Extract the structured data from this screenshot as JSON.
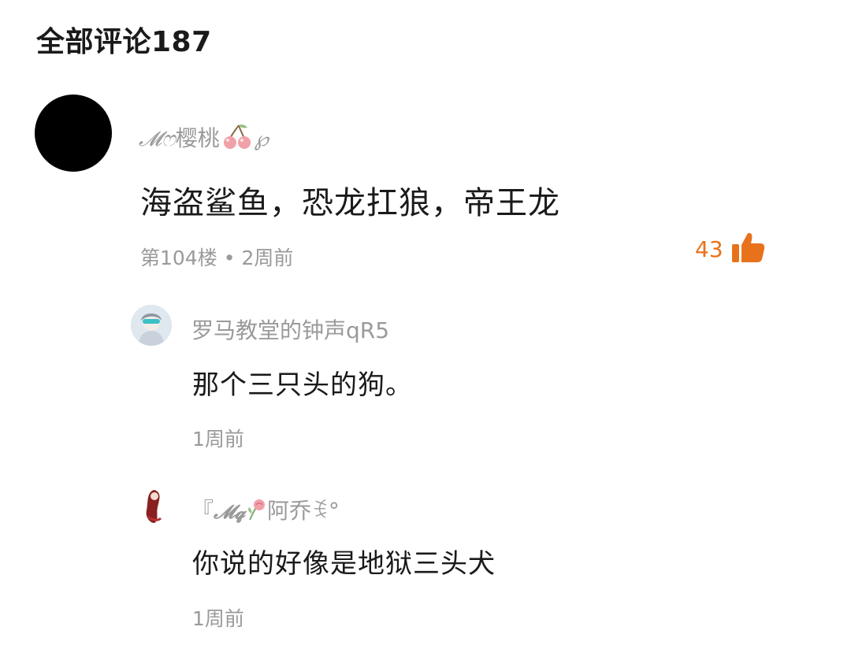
{
  "comments_header": {
    "title": "全部评论187"
  },
  "main_comment": {
    "username_prefix": "𝓜ෆ",
    "username_name": "樱桃",
    "username_suffix": "℘",
    "content": "海盗鲨鱼，恐龙扛狼，帝王龙",
    "floor": "第104楼",
    "separator": "•",
    "time": "2周前",
    "like_count": "43",
    "colors": {
      "like_accent": "#e8721c"
    }
  },
  "replies": [
    {
      "username": "罗马教堂的钟声qR5",
      "content": "那个三只头的狗。",
      "time": "1周前"
    },
    {
      "username_prefix": "『",
      "username_deco": "𝓜𝓺",
      "username_name": "阿乔",
      "username_suffix": "ꉂ°",
      "content": "你说的好像是地狱三头犬",
      "time": "1周前"
    }
  ]
}
